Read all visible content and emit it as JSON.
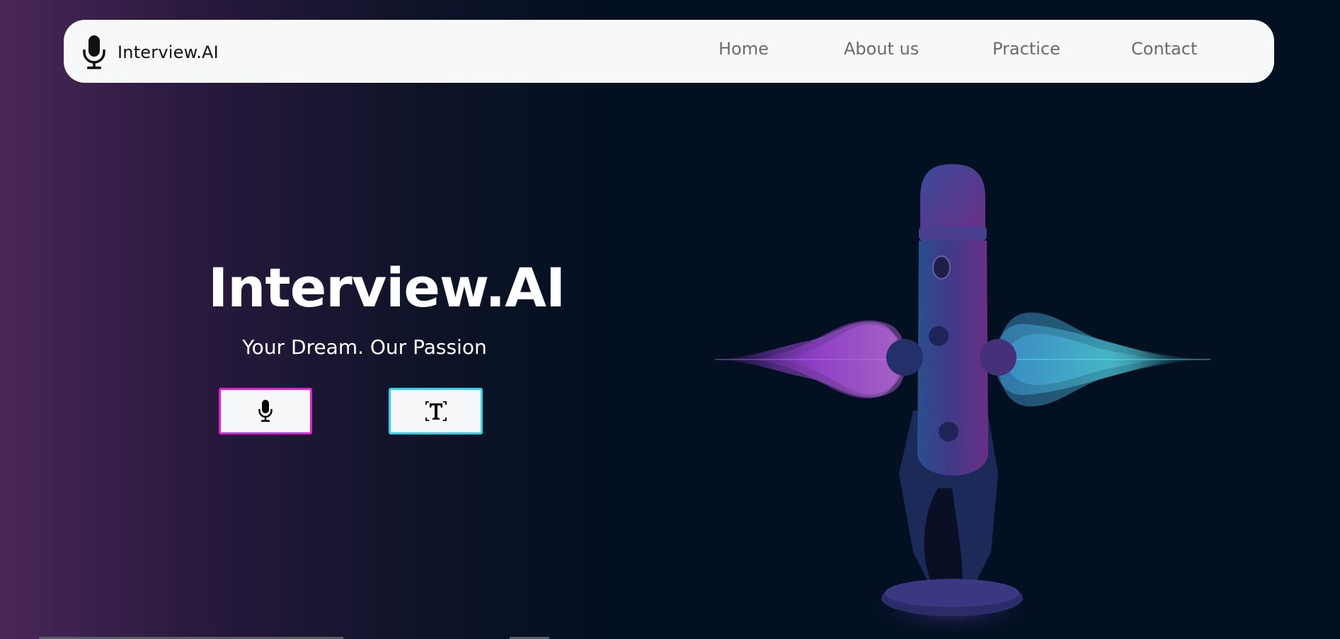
{
  "navbar": {
    "brand_name": "Interview.AI",
    "brand_icon": "microphone-icon",
    "links": [
      "Home",
      "About us",
      "Practice",
      "Contact"
    ]
  },
  "hero": {
    "title": "Interview.AI",
    "subtitle": "Your Dream. Our Passion",
    "voice_button_icon": "microphone-icon",
    "text_button_icon": "text-t-icon"
  },
  "colors": {
    "voice_accent": "#e21fd7",
    "text_accent": "#2bd3e6",
    "background_dark": "#031022",
    "background_purple": "#4a2658",
    "navbar_bg": "#f7f8fa"
  }
}
